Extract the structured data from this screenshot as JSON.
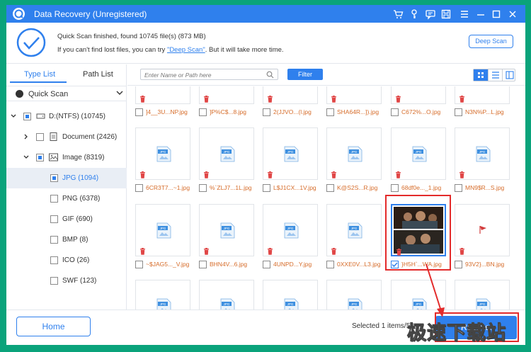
{
  "window": {
    "title": "Data Recovery (Unregistered)",
    "controls": [
      "cart-icon",
      "key-icon",
      "feedback-icon",
      "save-icon",
      "menu-icon",
      "minimize-icon",
      "maximize-icon",
      "close-icon"
    ]
  },
  "banner": {
    "line1": "Quick Scan finished, found 10745 file(s) (873 MB)",
    "line2_pre": "If you can't find lost files, you can try ",
    "line2_link": "\"Deep Scan\"",
    "line2_post": ". But it will take more time.",
    "deep_scan_button": "Deep Scan"
  },
  "sidebar": {
    "tabs": [
      "Type List",
      "Path List"
    ],
    "active_tab": "Type List",
    "scan_mode": "Quick Scan",
    "tree": [
      {
        "label": "D:(NTFS) (10745)",
        "icon": "drive-icon",
        "checked": "partial",
        "expanded": true
      },
      {
        "label": "Document (2426)",
        "icon": "document-icon",
        "checked": "none",
        "expanded": false
      },
      {
        "label": "Image (8319)",
        "icon": "image-icon",
        "checked": "partial",
        "expanded": true
      },
      {
        "label": "JPG (1094)",
        "checked": "partial",
        "selected": true
      },
      {
        "label": "PNG (6378)",
        "checked": "none"
      },
      {
        "label": "GIF (690)",
        "checked": "none"
      },
      {
        "label": "BMP (8)",
        "checked": "none"
      },
      {
        "label": "ICO (26)",
        "checked": "none"
      },
      {
        "label": "SWF (123)",
        "checked": "none"
      }
    ]
  },
  "toolbar": {
    "search_placeholder": "Enter Name or Path here",
    "filter_label": "Filter",
    "view_mode": "grid"
  },
  "files": [
    [
      "]4__3U...NP.jpg",
      "]P%C$...8.jpg",
      "2(JJVO...(l.jpg",
      "SHA64R...]).jpg",
      "C672%...O.jpg",
      "N3N%P...L.jpg"
    ],
    [
      "6CR3T7...~1.jpg",
      "%`ZLJ7...1L.jpg",
      "L$J1CX...1V.jpg",
      "K@S2S...R.jpg",
      "68df0e..._1.jpg",
      "MN9$R...S.jpg"
    ],
    [
      "~$JAG5..._V.jpg",
      "BHN4V...6.jpg",
      "4UNPD...Y.jpg",
      "0XXE0V...L3.jpg",
      "}H5H`...WA.jpg",
      "93V2}...BN.jpg"
    ],
    [
      "",
      "",
      "",
      "",
      "",
      ""
    ]
  ],
  "selected_file": "}H5H`...WA.jpg",
  "footer": {
    "home_label": "Home",
    "selected_text": "Selected 1 items/5",
    "recover_label": "Recover"
  },
  "watermark": "极速下载站"
}
